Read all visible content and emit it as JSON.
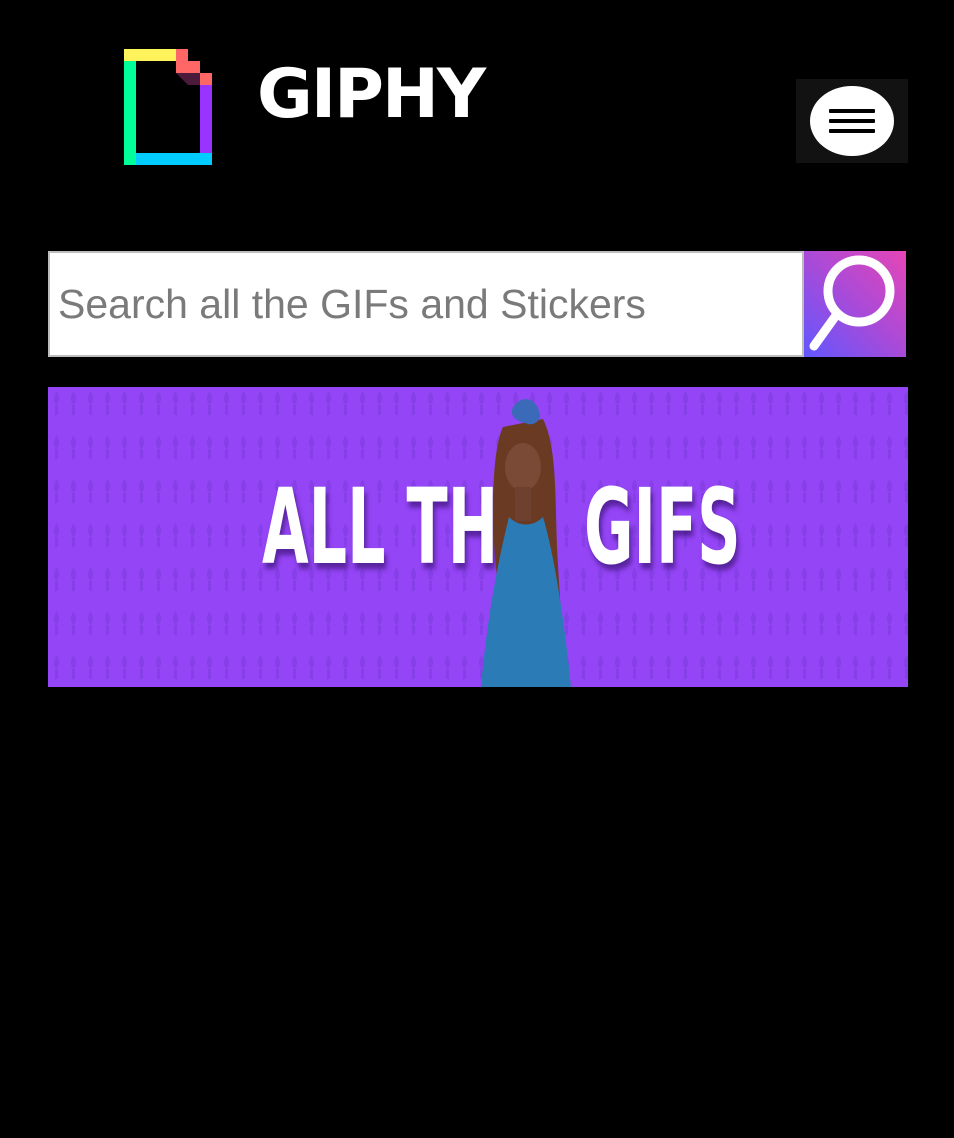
{
  "header": {
    "logo_text": "GIPHY",
    "logo_icon": "giphy-logo-icon",
    "menu_icon": "hamburger-menu-icon"
  },
  "search": {
    "placeholder": "Search all the GIFs and Stickers",
    "value": "",
    "button_icon": "search-icon"
  },
  "banner": {
    "text_left": "ALL THE",
    "text_right": "GIFS"
  },
  "colors": {
    "background": "#000000",
    "banner_purple": "#9445f5",
    "search_gradient_start": "#6157ff",
    "search_gradient_end": "#e646b6",
    "logo_green": "#00ff99",
    "logo_yellow": "#fff35c",
    "logo_red": "#ff6666",
    "logo_purple": "#9933ff",
    "logo_blue": "#00ccff"
  }
}
